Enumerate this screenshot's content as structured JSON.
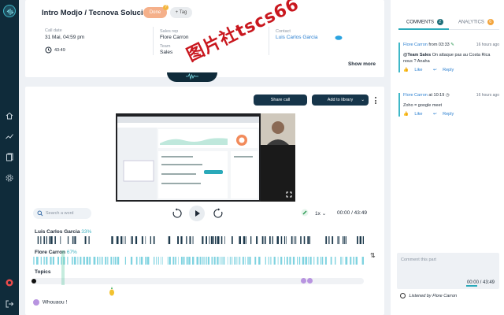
{
  "header": {
    "title": "Intro Modjo / Tecnova Soluciones",
    "status_badge": "Done",
    "status_badge_count": "?",
    "tag_button": "+ Tag",
    "call_date_label": "Call date",
    "call_date_value": "31 Mai, 04:59 pm",
    "duration_value": "43:49",
    "sales_rep_label": "Sales rep",
    "sales_rep_value": "Flore Carron",
    "team_label": "Team",
    "team_value": "Sales",
    "contact_label": "Contact",
    "contact_value": "Luis Carlos Garcia",
    "show_more": "Show more"
  },
  "toolbar": {
    "share_label": "Share call",
    "library_label": "Add to library"
  },
  "player": {
    "search_placeholder": "Search a word",
    "speed": "1x",
    "time": "00:00 / 43:49"
  },
  "tracks": {
    "speaker1_name": "Luis Carlos Garcia",
    "speaker1_pct": "33%",
    "speaker2_name": "Flore Carron",
    "speaker2_pct": "67%",
    "speaker1_share": 0.33,
    "speaker2_share": 0.67,
    "topics_label": "Topics",
    "reaction_text": "Whouaou !"
  },
  "panel": {
    "comments_tab": "COMMENTS",
    "comments_count": "2",
    "analytics_tab": "ANALYTICS",
    "analytics_count": "6",
    "comments": [
      {
        "author": "Flore Carron",
        "time_prefix": "from 03:33",
        "ago": "16 hours ago",
        "mention": "@Team Sales",
        "text": "On attaque pas au Costa Rica nous ? Anaha",
        "like": "Like",
        "reply": "Reply"
      },
      {
        "author": "Flore Carron",
        "time_prefix": "at 10:19",
        "ago": "16 hours ago",
        "mention": "",
        "text": "Zoho = google meet",
        "like": "Like",
        "reply": "Reply"
      }
    ],
    "compose_placeholder": "Comment this part",
    "compose_time": "00:00 / 43:49",
    "listened_by": "Listened by Flore Carron"
  },
  "watermark": "图片社tscs66",
  "colors": {
    "accent": "#2aa9b9",
    "sidebar": "#0f2b3a",
    "done_badge": "#f5b08a",
    "speaker1": "#1e3a4c",
    "speaker2": "#7fd3e0",
    "topic_dot": "#b894e0"
  }
}
